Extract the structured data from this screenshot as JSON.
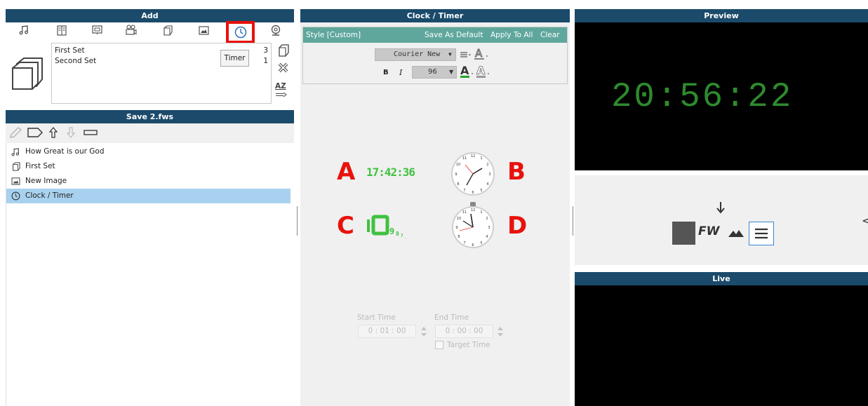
{
  "add_panel": {
    "header": "Add",
    "tooltip": "Timer",
    "sets": [
      {
        "name": "First Set",
        "count": "3"
      },
      {
        "name": "Second Set",
        "count": "1"
      }
    ],
    "sort_label": "AZ",
    "icons": [
      "music-note-icon",
      "book-icon",
      "presentation-icon",
      "video-camera-icon",
      "set-icon",
      "image-icon",
      "clock-icon",
      "webcam-icon"
    ]
  },
  "save_panel": {
    "header": "Save 2.fws",
    "items": [
      {
        "label": "How Great is our God",
        "icon": "music-note-icon"
      },
      {
        "label": "First Set",
        "icon": "set-icon"
      },
      {
        "label": "New Image",
        "icon": "image-icon"
      },
      {
        "label": "Clock / Timer",
        "icon": "clock-icon"
      }
    ]
  },
  "clock_panel": {
    "header": "Clock / Timer",
    "style_label": "Style [Custom]",
    "save_default": "Save As Default",
    "apply_all": "Apply To All",
    "clear": "Clear",
    "font_name": "Courier New",
    "font_size": "96",
    "bold": "B",
    "italic": "I",
    "marks": {
      "a": "A",
      "b": "B",
      "c": "C",
      "d": "D"
    },
    "digital_sample": "17:42:36",
    "start_time_label": "Start Time",
    "start_time_value": "0 : 01 : 00",
    "end_time_label": "End Time",
    "end_time_value": "0 : 00 : 00",
    "target_time_label": "Target Time",
    "accent_green": "#3fc23f"
  },
  "preview_panel": {
    "header": "Preview",
    "time": "20:56:22",
    "clock_color": "#2e8b2e"
  },
  "live_panel": {
    "header": "Live"
  },
  "mode_bar": {
    "fw_label": "FW"
  }
}
